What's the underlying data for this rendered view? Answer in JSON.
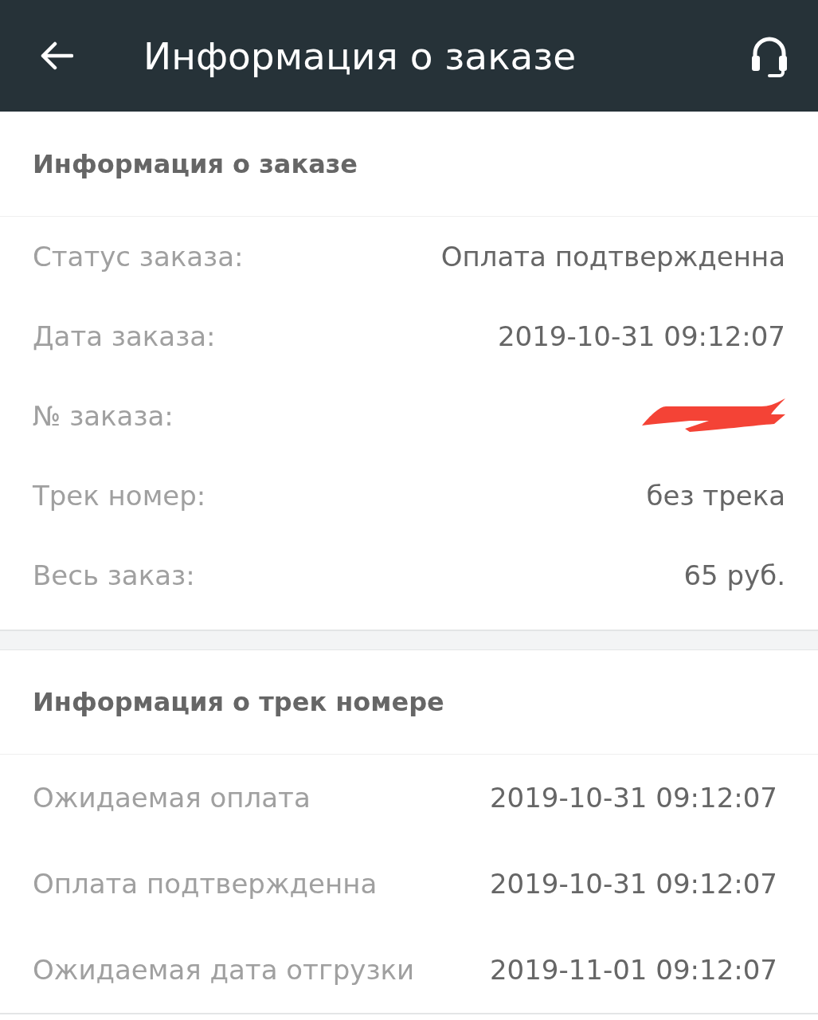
{
  "app_bar": {
    "title": "Информация о заказе"
  },
  "order_info": {
    "title": "Информация о заказе",
    "rows": [
      {
        "kind": "text",
        "label": "Статус заказа:",
        "value": "Оплата подтвержденна"
      },
      {
        "kind": "text",
        "label": "Дата заказа:",
        "value": "2019-10-31 09:12:07"
      },
      {
        "kind": "redacted",
        "label": "№ заказа:"
      },
      {
        "kind": "text",
        "label": "Трек номер:",
        "value": "без трека"
      },
      {
        "kind": "text",
        "label": "Весь заказ:",
        "value": "65 руб."
      }
    ]
  },
  "track_info": {
    "title": "Информация о трек номере",
    "rows": [
      {
        "kind": "text",
        "label": "Ожидаемая оплата",
        "value": "2019-10-31 09:12:07"
      },
      {
        "kind": "text",
        "label": "Оплата подтвержденна",
        "value": "2019-10-31 09:12:07"
      },
      {
        "kind": "text",
        "label": "Ожидаемая дата отгрузки",
        "value": "2019-11-01 09:12:07"
      }
    ]
  }
}
